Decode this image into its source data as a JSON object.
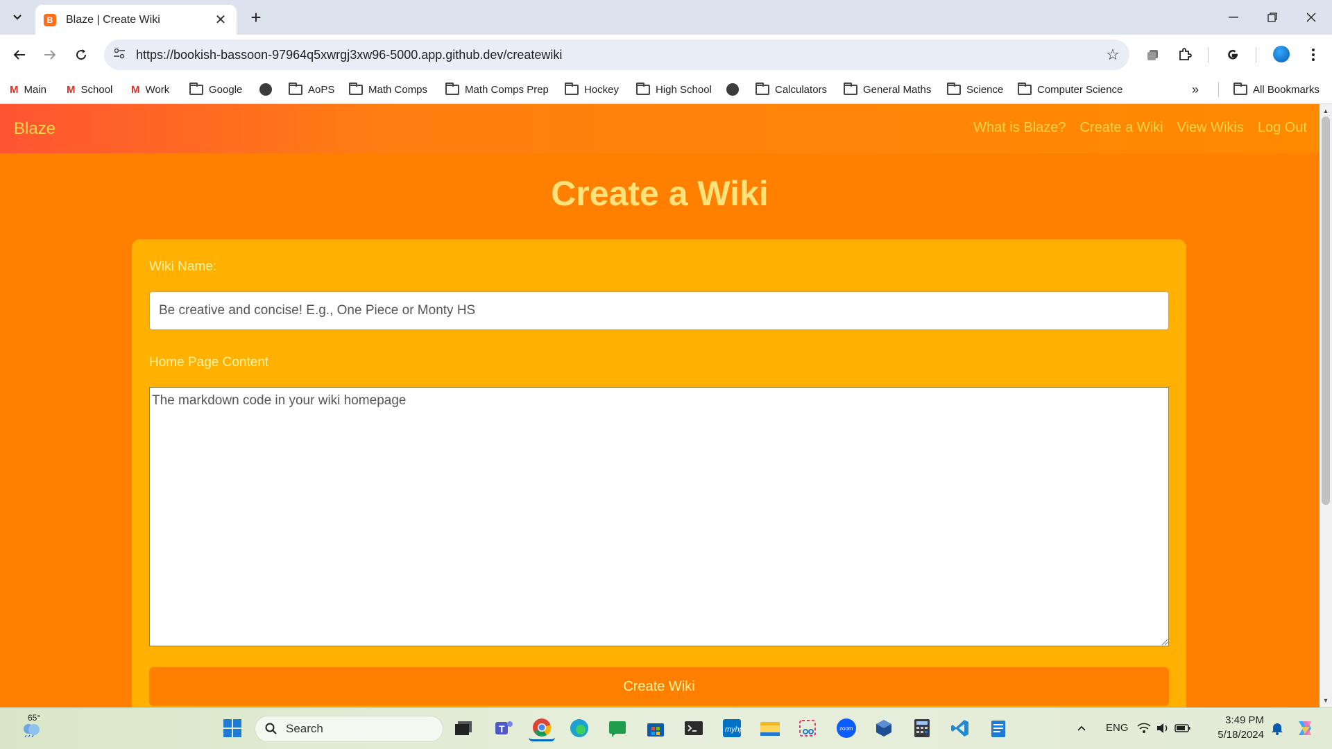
{
  "browser": {
    "tab": {
      "title": "Blaze | Create Wiki",
      "favicon_letter": "B",
      "close_glyph": "✕"
    },
    "new_tab_glyph": "+",
    "url": "https://bookish-bassoon-97964q5xwrgj3xw96-5000.app.github.dev/createwiki",
    "bookmarks": [
      {
        "label": "Main",
        "icon": "gmail-icon"
      },
      {
        "label": "School",
        "icon": "gmail-icon"
      },
      {
        "label": "Work",
        "icon": "gmail-icon"
      },
      {
        "label": "Google",
        "icon": "folder-icon"
      },
      {
        "label": "",
        "icon": "globe-icon"
      },
      {
        "label": "AoPS",
        "icon": "folder-icon"
      },
      {
        "label": "Math Comps",
        "icon": "folder-icon"
      },
      {
        "label": "Math Comps Prep",
        "icon": "folder-icon"
      },
      {
        "label": "Hockey",
        "icon": "folder-icon"
      },
      {
        "label": "High School",
        "icon": "folder-icon"
      },
      {
        "label": "",
        "icon": "globe-icon"
      },
      {
        "label": "Calculators",
        "icon": "folder-icon"
      },
      {
        "label": "General Maths",
        "icon": "folder-icon"
      },
      {
        "label": "Science",
        "icon": "folder-icon"
      },
      {
        "label": "Computer Science",
        "icon": "folder-icon"
      }
    ],
    "all_bookmarks": "All Bookmarks"
  },
  "app": {
    "brand": "Blaze",
    "nav": [
      "What is Blaze?",
      "Create a Wiki",
      "View Wikis",
      "Log Out"
    ],
    "heading": "Create a Wiki",
    "form": {
      "name_label": "Wiki Name:",
      "name_placeholder": "Be creative and concise! E.g., One Piece or Monty HS",
      "content_label": "Home Page Content",
      "content_placeholder": "The markdown code in your wiki homepage",
      "submit_label": "Create Wiki"
    },
    "colors": {
      "accent": "#ff7f00",
      "card": "#ffb000",
      "text_accent": "#ffd54a"
    }
  },
  "taskbar": {
    "weather": "65°",
    "search_label": "Search",
    "language": "ENG",
    "time": "3:49 PM",
    "date": "5/18/2024"
  }
}
